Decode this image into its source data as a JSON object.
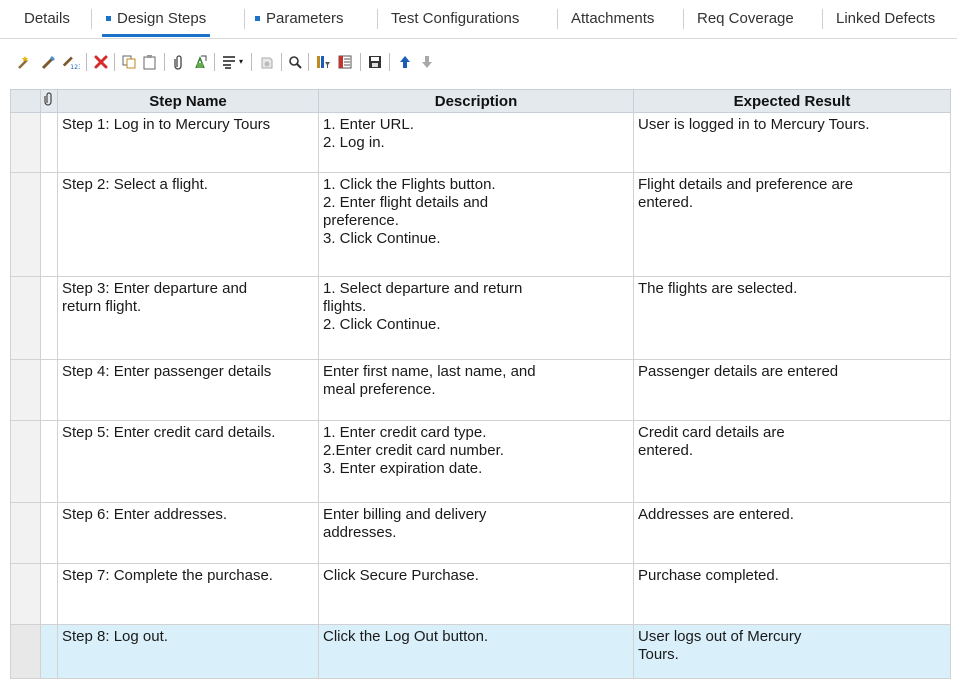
{
  "tabs": [
    {
      "label": "Details"
    },
    {
      "label": "Design Steps"
    },
    {
      "label": "Parameters"
    },
    {
      "label": "Test Configurations"
    },
    {
      "label": "Attachments"
    },
    {
      "label": "Req Coverage"
    },
    {
      "label": "Linked Defects"
    }
  ],
  "active_tab": "Design Steps",
  "columns": {
    "attachment": "📎",
    "step_name": "Step Name",
    "description": "Description",
    "expected": "Expected Result"
  },
  "rows": [
    {
      "name": "Step 1:  Log in to Mercury Tours",
      "description": "1. Enter URL.\n2. Log in.",
      "expected": "User is logged in to Mercury Tours."
    },
    {
      "name": "Step 2: Select a flight.",
      "description": "1. Click the Flights button.\n2. Enter flight details and\npreference.\n3. Click Continue.",
      "expected": "Flight details and preference are\nentered."
    },
    {
      "name": "Step 3: Enter departure and\nreturn flight.",
      "description": "1. Select departure and return\nflights.\n2. Click Continue.",
      "expected": "The flights are selected."
    },
    {
      "name": "Step 4: Enter passenger details",
      "description": "Enter first name, last name, and\nmeal preference.",
      "expected": "Passenger details are entered"
    },
    {
      "name": "Step 5: Enter credit card details.",
      "description": "1. Enter credit card type.\n2.Enter credit card number.\n3. Enter expiration date.",
      "expected": "Credit card details are\nentered."
    },
    {
      "name": "Step 6: Enter addresses.",
      "description": "Enter billing and delivery\naddresses.",
      "expected": "Addresses are entered."
    },
    {
      "name": "Step 7: Complete the purchase.",
      "description": "Click Secure Purchase.",
      "expected": "Purchase completed."
    },
    {
      "name": "Step 8: Log out.",
      "description": "Click the Log Out button.",
      "expected": "User logs out of Mercury\nTours."
    }
  ],
  "selected_row": 8,
  "toolbar_icons": [
    "new-step-icon",
    "edit-step-icon",
    "renumber-steps-icon",
    "delete-icon",
    "copy-icon",
    "paste-icon",
    "attachment-icon",
    "call-to-test-icon",
    "insert-parameter-icon",
    "generate-script-icon",
    "find-icon",
    "grid-filter-icon",
    "select-columns-icon",
    "save-icon",
    "move-up-icon",
    "move-down-icon"
  ],
  "colors": {
    "accent": "#1a73c8",
    "delete": "#d62b2b",
    "selected_row": "#d9f0fb",
    "header_bg": "#e4e9ee"
  }
}
